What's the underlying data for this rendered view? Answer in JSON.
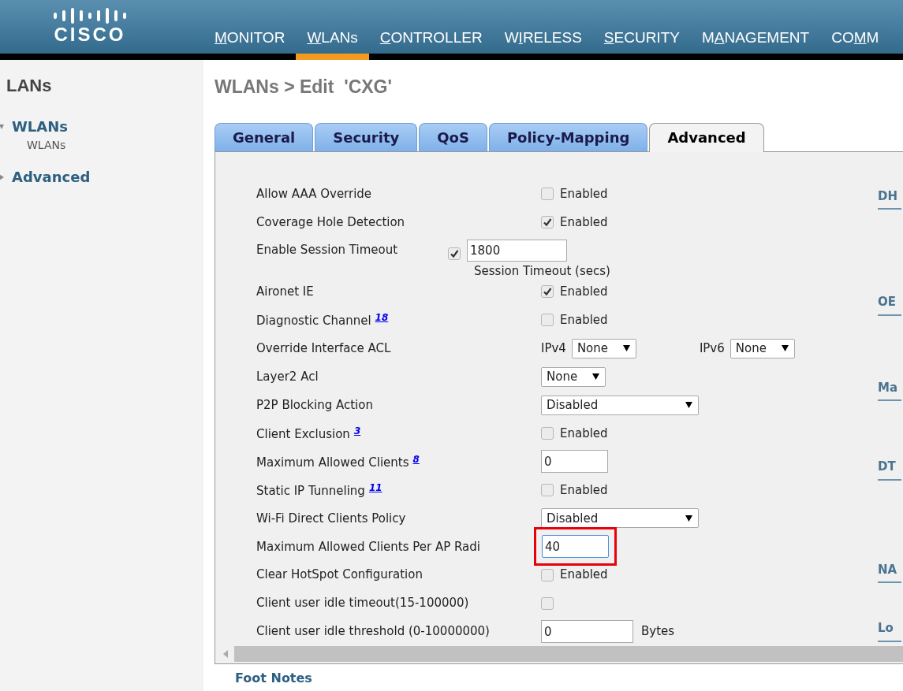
{
  "brand": {
    "name": "CISCO"
  },
  "nav": [
    {
      "segments": [
        {
          "text": "M",
          "underlined": true
        },
        {
          "text": "ONITOR",
          "underlined": false
        }
      ],
      "selected": false
    },
    {
      "segments": [
        {
          "text": "W",
          "underlined": true
        },
        {
          "text": "LANs",
          "underlined": false
        }
      ],
      "selected": true
    },
    {
      "segments": [
        {
          "text": "C",
          "underlined": true
        },
        {
          "text": "ONTROLLER",
          "underlined": false
        }
      ],
      "selected": false
    },
    {
      "segments": [
        {
          "text": "W",
          "underlined": false
        },
        {
          "text": "I",
          "underlined": true
        },
        {
          "text": "RELESS",
          "underlined": false
        }
      ],
      "selected": false
    },
    {
      "segments": [
        {
          "text": "S",
          "underlined": true
        },
        {
          "text": "ECURITY",
          "underlined": false
        }
      ],
      "selected": false
    },
    {
      "segments": [
        {
          "text": "M",
          "underlined": false
        },
        {
          "text": "A",
          "underlined": true
        },
        {
          "text": "NAGEMENT",
          "underlined": false
        }
      ],
      "selected": false
    },
    {
      "segments": [
        {
          "text": "CO",
          "underlined": false
        },
        {
          "text": "M",
          "underlined": true
        },
        {
          "text": "M",
          "underlined": false
        }
      ],
      "selected": false
    }
  ],
  "sidebar": {
    "title": "LANs",
    "items": [
      {
        "label": "WLANs",
        "expanded": true,
        "children": [
          {
            "label": "WLANs"
          }
        ]
      },
      {
        "label": "Advanced",
        "expanded": false
      }
    ]
  },
  "page_title": "WLANs > Edit  'CXG'",
  "tabs": [
    {
      "label": "General",
      "selected": false
    },
    {
      "label": "Security",
      "selected": false
    },
    {
      "label": "QoS",
      "selected": false
    },
    {
      "label": "Policy-Mapping",
      "selected": false
    },
    {
      "label": "Advanced",
      "selected": true
    }
  ],
  "rows": [
    {
      "kind": "checkbox",
      "label": "Allow AAA Override",
      "checked": false,
      "option": "Enabled"
    },
    {
      "kind": "checkbox",
      "label": "Coverage Hole Detection",
      "checked": true,
      "option": "Enabled"
    },
    {
      "kind": "session",
      "label": "Enable Session Timeout",
      "checked": true,
      "value": "1800",
      "caption": "Session Timeout (secs)"
    },
    {
      "kind": "checkbox",
      "label": "Aironet IE",
      "checked": true,
      "option": "Enabled"
    },
    {
      "kind": "checkbox",
      "label": "Diagnostic Channel",
      "footnote": "18",
      "checked": false,
      "option": "Enabled"
    },
    {
      "kind": "acl",
      "label": "Override Interface ACL",
      "selects": [
        {
          "prefix": "IPv4",
          "value": "None"
        },
        {
          "prefix": "IPv6",
          "value": "None"
        }
      ]
    },
    {
      "kind": "select",
      "label": "Layer2 Acl",
      "value": "None",
      "wide": false
    },
    {
      "kind": "select",
      "label": "P2P Blocking Action",
      "value": "Disabled",
      "wide": true
    },
    {
      "kind": "checkbox",
      "label": "Client Exclusion",
      "footnote": "3",
      "checked": false,
      "option": "Enabled"
    },
    {
      "kind": "input",
      "label": "Maximum Allowed Clients",
      "footnote": "8",
      "value": "0"
    },
    {
      "kind": "checkbox",
      "label": "Static IP Tunneling",
      "footnote": "11",
      "checked": false,
      "option": "Enabled"
    },
    {
      "kind": "select",
      "label": "Wi-Fi Direct Clients Policy",
      "value": "Disabled",
      "wide": true
    },
    {
      "kind": "input",
      "label": "Maximum Allowed Clients Per AP Radi",
      "value": "40",
      "highlighted": true,
      "focused": true
    },
    {
      "kind": "checkbox",
      "label": "Clear HotSpot Configuration",
      "checked": false,
      "option": "Enabled"
    },
    {
      "kind": "checkbox",
      "label": "Client user idle timeout(15-100000)",
      "checked": false
    },
    {
      "kind": "input",
      "label": "Client user idle threshold (0-10000000)",
      "value": "0",
      "unit": "Bytes"
    }
  ],
  "side_sections": [
    "DH",
    "OE",
    "Ma",
    "DT",
    "NA",
    "Lo"
  ],
  "footer": {
    "title": "Foot Notes"
  }
}
